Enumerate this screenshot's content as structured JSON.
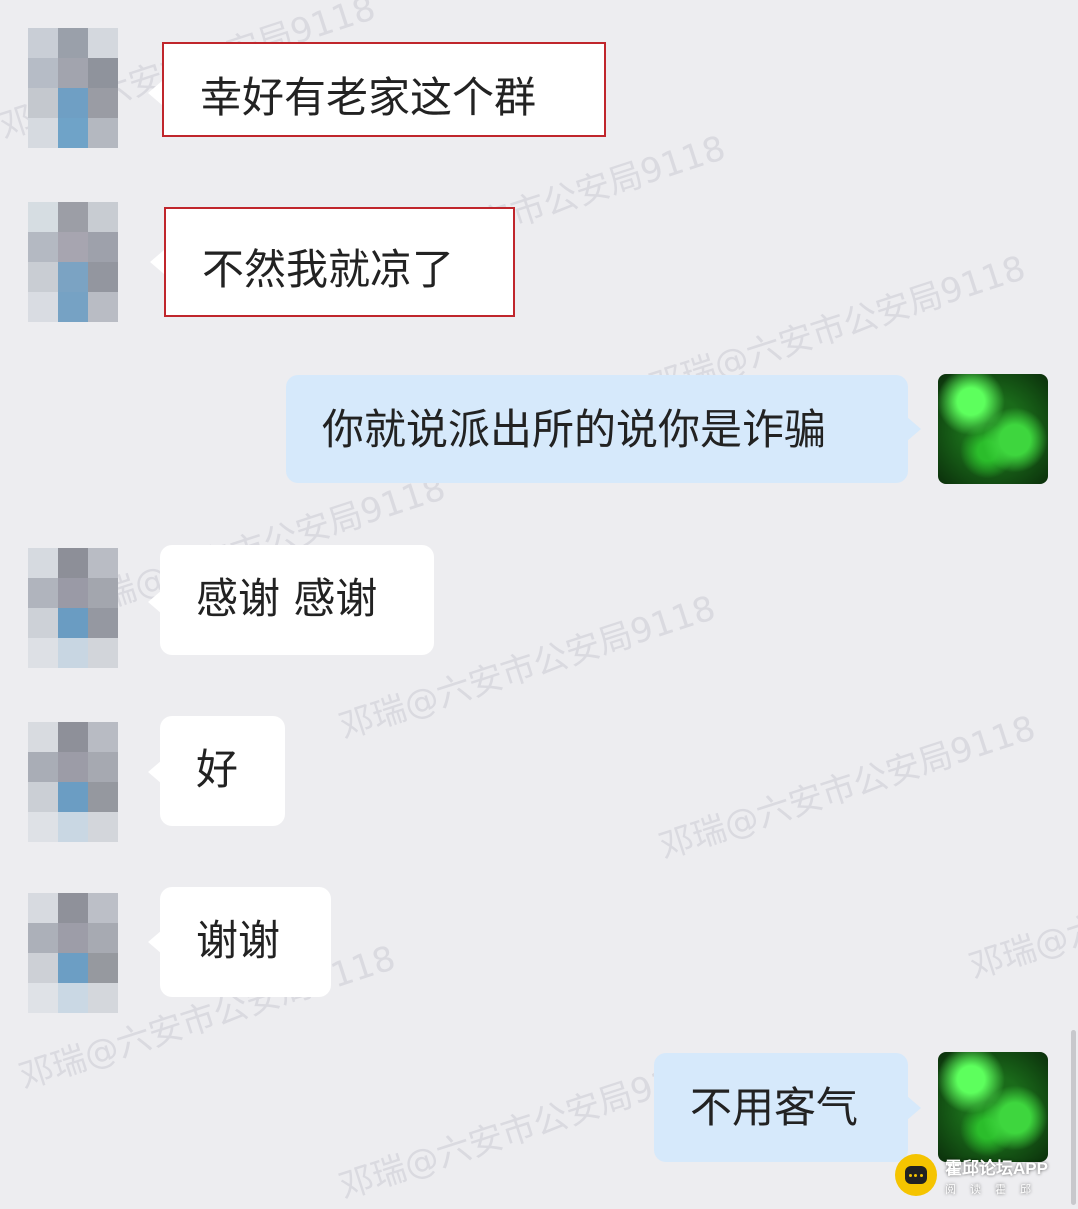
{
  "watermark": "邓瑞@六安市公安局9118",
  "messages": [
    {
      "side": "left",
      "text": "幸好有老家这个群",
      "highlighted": true
    },
    {
      "side": "left",
      "text": "不然我就凉了",
      "highlighted": true
    },
    {
      "side": "right",
      "text": "你就说派出所的说你是诈骗"
    },
    {
      "side": "left",
      "text": "感谢 感谢"
    },
    {
      "side": "left",
      "text": "好"
    },
    {
      "side": "left",
      "text": "谢谢"
    },
    {
      "side": "right",
      "text": "不用客气"
    }
  ],
  "badge": {
    "title": "霍邱论坛APP",
    "subtitle": "阅读霍邱"
  },
  "colors": {
    "background": "#ededf0",
    "incoming_bubble": "#ffffff",
    "outgoing_bubble": "#d6e9fb",
    "highlight_border": "#c0262c"
  }
}
